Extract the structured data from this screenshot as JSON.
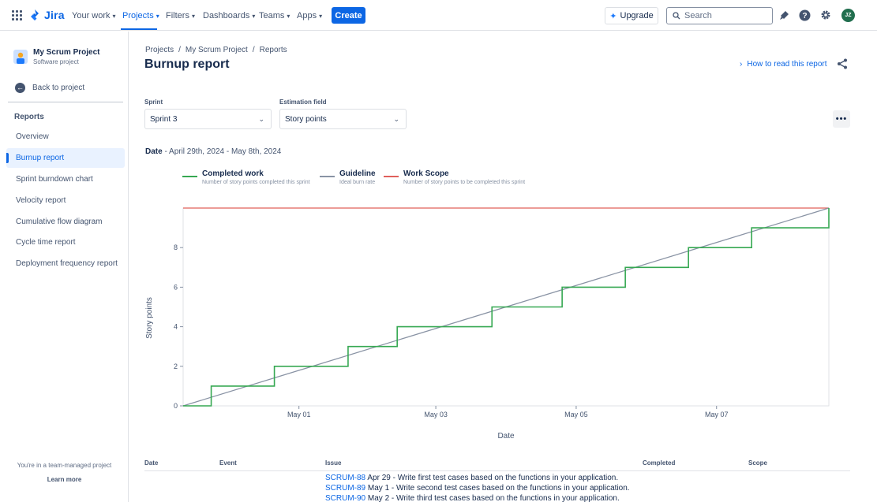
{
  "topnav": {
    "logo": "Jira",
    "items": [
      "Your work",
      "Projects",
      "Filters",
      "Dashboards",
      "Teams",
      "Apps"
    ],
    "active_item": "Projects",
    "create_label": "Create",
    "upgrade_label": "Upgrade",
    "search_placeholder": "Search",
    "avatar_initials": "JZ"
  },
  "sidebar": {
    "project_name": "My Scrum Project",
    "project_type": "Software project",
    "back_label": "Back to project",
    "section_heading": "Reports",
    "items": [
      "Overview",
      "Burnup report",
      "Sprint burndown chart",
      "Velocity report",
      "Cumulative flow diagram",
      "Cycle time report",
      "Deployment frequency report"
    ],
    "selected_item": "Burnup report",
    "footer_text": "You're in a team-managed project",
    "footer_link": "Learn more"
  },
  "main": {
    "breadcrumbs": [
      "Projects",
      "My Scrum Project",
      "Reports"
    ],
    "title": "Burnup report",
    "how_link": "How to read this report",
    "sprint_label": "Sprint",
    "sprint_value": "Sprint 3",
    "estimation_label": "Estimation field",
    "estimation_value": "Story points",
    "date_label": "Date",
    "date_range": " - April 29th, 2024 - May 8th, 2024"
  },
  "legend": [
    {
      "title": "Completed work",
      "desc": "Number of story points completed this sprint",
      "color": "#36a852"
    },
    {
      "title": "Guideline",
      "desc": "Ideal burn rate",
      "color": "#8993a4"
    },
    {
      "title": "Work Scope",
      "desc": "Number of story points to be completed this sprint",
      "color": "#e0605b"
    }
  ],
  "chart_data": {
    "type": "line",
    "xlabel": "Date",
    "ylabel": "Story points",
    "x_tick_labels": [
      "May 01",
      "May 03",
      "May 05",
      "May 07"
    ],
    "x_tick_days": [
      1.65,
      3.6,
      5.6,
      7.6
    ],
    "x_range_days": [
      0,
      9.2
    ],
    "y_ticks": [
      0,
      2,
      4,
      6,
      8
    ],
    "ylim": [
      0,
      10
    ],
    "series": [
      {
        "name": "Completed work",
        "color": "#36a852",
        "step": true,
        "points": [
          [
            0,
            0
          ],
          [
            0.4,
            1
          ],
          [
            1.3,
            2
          ],
          [
            2.35,
            3
          ],
          [
            3.05,
            4
          ],
          [
            4.4,
            5
          ],
          [
            5.4,
            6
          ],
          [
            6.3,
            7
          ],
          [
            7.2,
            8
          ],
          [
            8.1,
            9
          ],
          [
            9.2,
            10
          ]
        ]
      },
      {
        "name": "Guideline",
        "color": "#8993a4",
        "points": [
          [
            0,
            0
          ],
          [
            9.2,
            10
          ]
        ]
      },
      {
        "name": "Work Scope",
        "color": "#e0605b",
        "points": [
          [
            0,
            10
          ],
          [
            9.2,
            10
          ]
        ]
      }
    ]
  },
  "table": {
    "headers": [
      "Date",
      "Event",
      "Issue",
      "Completed",
      "Scope"
    ],
    "rows": [
      {
        "key": "SCRUM-88",
        "text": " Apr 29 - Write first test cases based on the functions in your application."
      },
      {
        "key": "SCRUM-89",
        "text": " May 1 - Write second test cases based on the functions in your application."
      },
      {
        "key": "SCRUM-90",
        "text": " May 2 - Write third test cases based on the functions in your application."
      }
    ]
  }
}
